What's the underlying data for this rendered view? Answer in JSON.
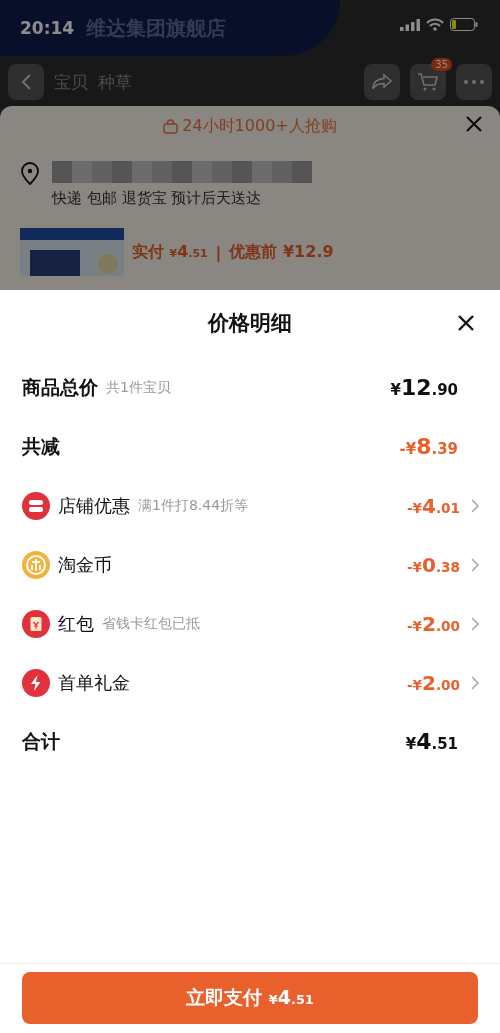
{
  "status_bar": {
    "time": "20:14"
  },
  "store_header": {
    "name": "维达集团旗舰店"
  },
  "nav": {
    "tabs": [
      "宝贝",
      "种草"
    ],
    "cart_count": "35"
  },
  "order_sheet": {
    "banner": "24小时1000+人抢购",
    "delivery": "快递 包邮 退货宝 预计后天送达",
    "paid_label": "实付",
    "paid_amount": "¥4.51",
    "separator": "|",
    "before_label": "优惠前",
    "before_amount": "¥12.9"
  },
  "detail_sheet": {
    "title": "价格明细",
    "subtotal": {
      "label": "商品总价",
      "note": "共1件宝贝",
      "amount": "¥12.90"
    },
    "reduction": {
      "label": "共减",
      "amount": "-¥8.39"
    },
    "discounts": [
      {
        "kind": "store",
        "label": "店铺优惠",
        "note": "满1件打8.44折等",
        "amount": "-¥4.01"
      },
      {
        "kind": "coin",
        "label": "淘金币",
        "amount": "-¥0.38"
      },
      {
        "kind": "redpacket",
        "label": "红包",
        "note": "省钱卡红包已抵",
        "amount": "-¥2.00"
      },
      {
        "kind": "gift",
        "label": "首单礼金",
        "amount": "-¥2.00"
      }
    ],
    "total": {
      "label": "合计",
      "amount": "¥4.51"
    }
  },
  "pay_button": {
    "label": "立即支付",
    "amount": "¥4.51"
  }
}
